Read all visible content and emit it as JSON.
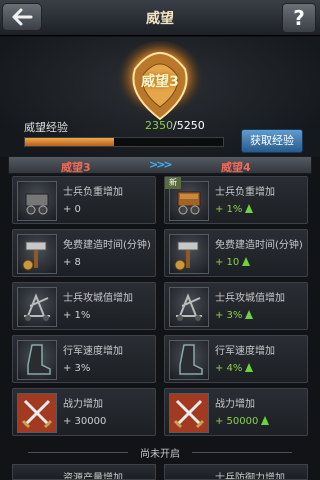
{
  "header": {
    "title": "威望",
    "help_label": "?"
  },
  "banner": {
    "emblem_text": "威望3",
    "exp_label": "威望经验",
    "exp_current": "2350",
    "exp_total": "/5250",
    "exp_progress": 0.4476,
    "gain_button": "获取经验"
  },
  "compare": {
    "left_level": "威望3",
    "right_level": "威望4",
    "arrows": ">>>"
  },
  "rows": [
    {
      "label_left": "士兵负重增加",
      "value_left": "+ 0",
      "label_right": "士兵负重增加",
      "value_right": "+ 1%",
      "icon": "cart-icon",
      "new": "新"
    },
    {
      "label_left": "免费建造时间(分钟)",
      "value_left": "+ 8",
      "label_right": "免费建造时间(分钟)",
      "value_right": "+ 10",
      "icon": "hammer-icon"
    },
    {
      "label_left": "士兵攻城值增加",
      "value_left": "+ 1%",
      "label_right": "士兵攻城值增加",
      "value_right": "+ 3%",
      "icon": "catapult-icon"
    },
    {
      "label_left": "行军速度增加",
      "value_left": "+ 3%",
      "label_right": "行军速度增加",
      "value_right": "+ 4%",
      "icon": "boot-icon"
    },
    {
      "label_left": "战力增加",
      "value_left": "+ 30000",
      "label_right": "战力增加",
      "value_right": "+ 50000",
      "icon": "crossed-swords-icon"
    }
  ],
  "locked": {
    "text": "尚未开启"
  },
  "peek": {
    "left_label": "资源产量增加",
    "right_label": "士兵防御力增加"
  }
}
